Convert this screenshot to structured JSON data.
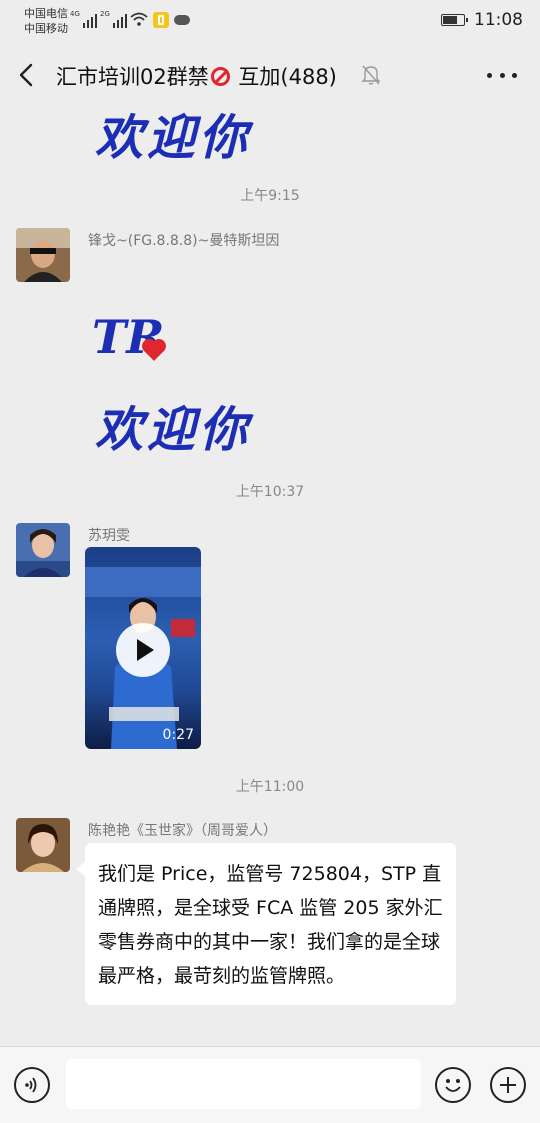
{
  "status_bar": {
    "carrier_1": "中国电信",
    "carrier_2": "中国移动",
    "net_1": "4G",
    "net_2": "2G",
    "time": "11:08",
    "battery_level": 0.75
  },
  "header": {
    "title_part1": "汇市培训02群禁",
    "title_part2": " 互加(488)",
    "icons": [
      "back-arrow-icon",
      "no-entry-icon",
      "mute-bell-icon",
      "more-icon"
    ]
  },
  "messages": [
    {
      "type": "sticker",
      "text": "欢迎你"
    },
    {
      "type": "timestamp",
      "text": "上午9:15"
    },
    {
      "type": "sticker",
      "sender": "锋戈~(FG.8.8.8)~曼特斯坦因",
      "logo": "TR",
      "text": "欢迎你"
    },
    {
      "type": "timestamp",
      "text": "上午10:37"
    },
    {
      "type": "video",
      "sender": "苏玥雯",
      "duration": "0:27"
    },
    {
      "type": "timestamp",
      "text": "上午11:00"
    },
    {
      "type": "text",
      "sender": "陈艳艳《玉世家》（周哥爱人）",
      "text": "我们是 Price，监管号 725804，STP 直通牌照，是全球受 FCA 监管 205 家外汇零售券商中的其中一家！我们拿的是全球最严格，最苛刻的监管牌照。"
    }
  ],
  "input_bar": {
    "icons": [
      "voice-icon",
      "emoji-icon",
      "plus-icon"
    ]
  },
  "colors": {
    "background": "#ededed",
    "sticker_blue": "#1c2fb4",
    "ban_red": "#e0262e",
    "bubble": "#ffffff"
  }
}
